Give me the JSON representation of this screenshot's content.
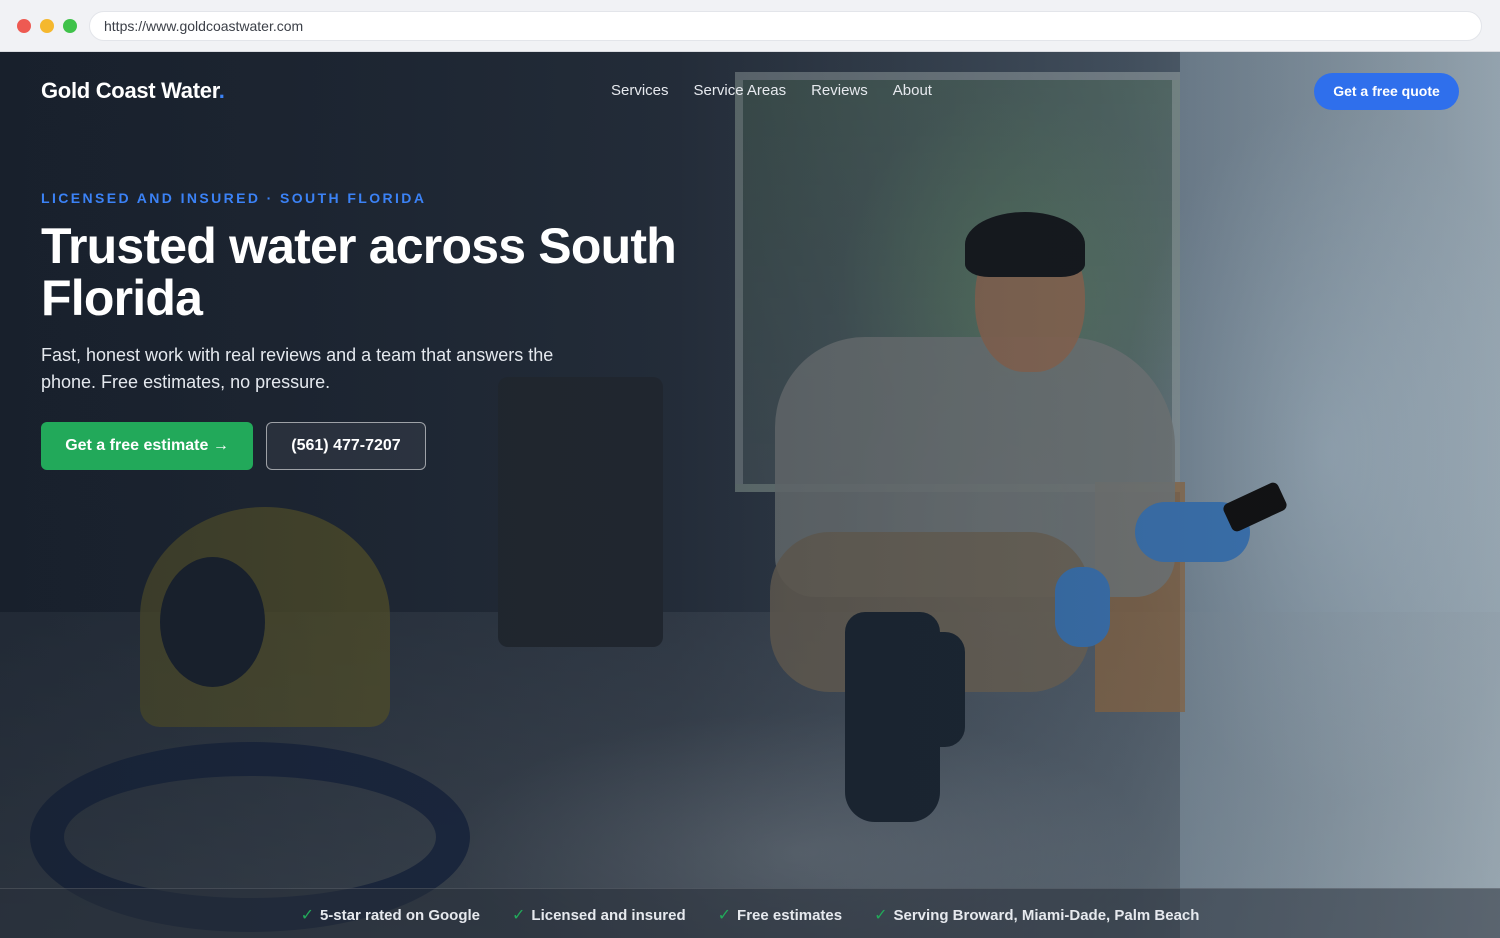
{
  "browser": {
    "url": "https://www.goldcoastwater.com"
  },
  "nav": {
    "logo_text": "Gold Coast Water",
    "logo_dot": ".",
    "links": [
      "Services",
      "Service Areas",
      "Reviews",
      "About"
    ],
    "cta_label": "Get a free quote"
  },
  "hero": {
    "eyebrow": "LICENSED AND INSURED · SOUTH FLORIDA",
    "headline": "Trusted water across South Florida",
    "subtext": "Fast, honest work with real reviews and a team that answers the phone. Free estimates, no pressure.",
    "primary_cta": "Get a free estimate →",
    "phone_cta": "(561) 477-7207"
  },
  "trust_bar": {
    "check_glyph": "✓",
    "items": [
      "5-star rated on Google",
      "Licensed and insured",
      "Free estimates",
      "Serving Broward, Miami-Dade, Palm Beach"
    ]
  },
  "colors": {
    "accent_blue": "#2f6fec",
    "cta_green": "#22a95a",
    "eyebrow_blue": "#3b82f6"
  }
}
